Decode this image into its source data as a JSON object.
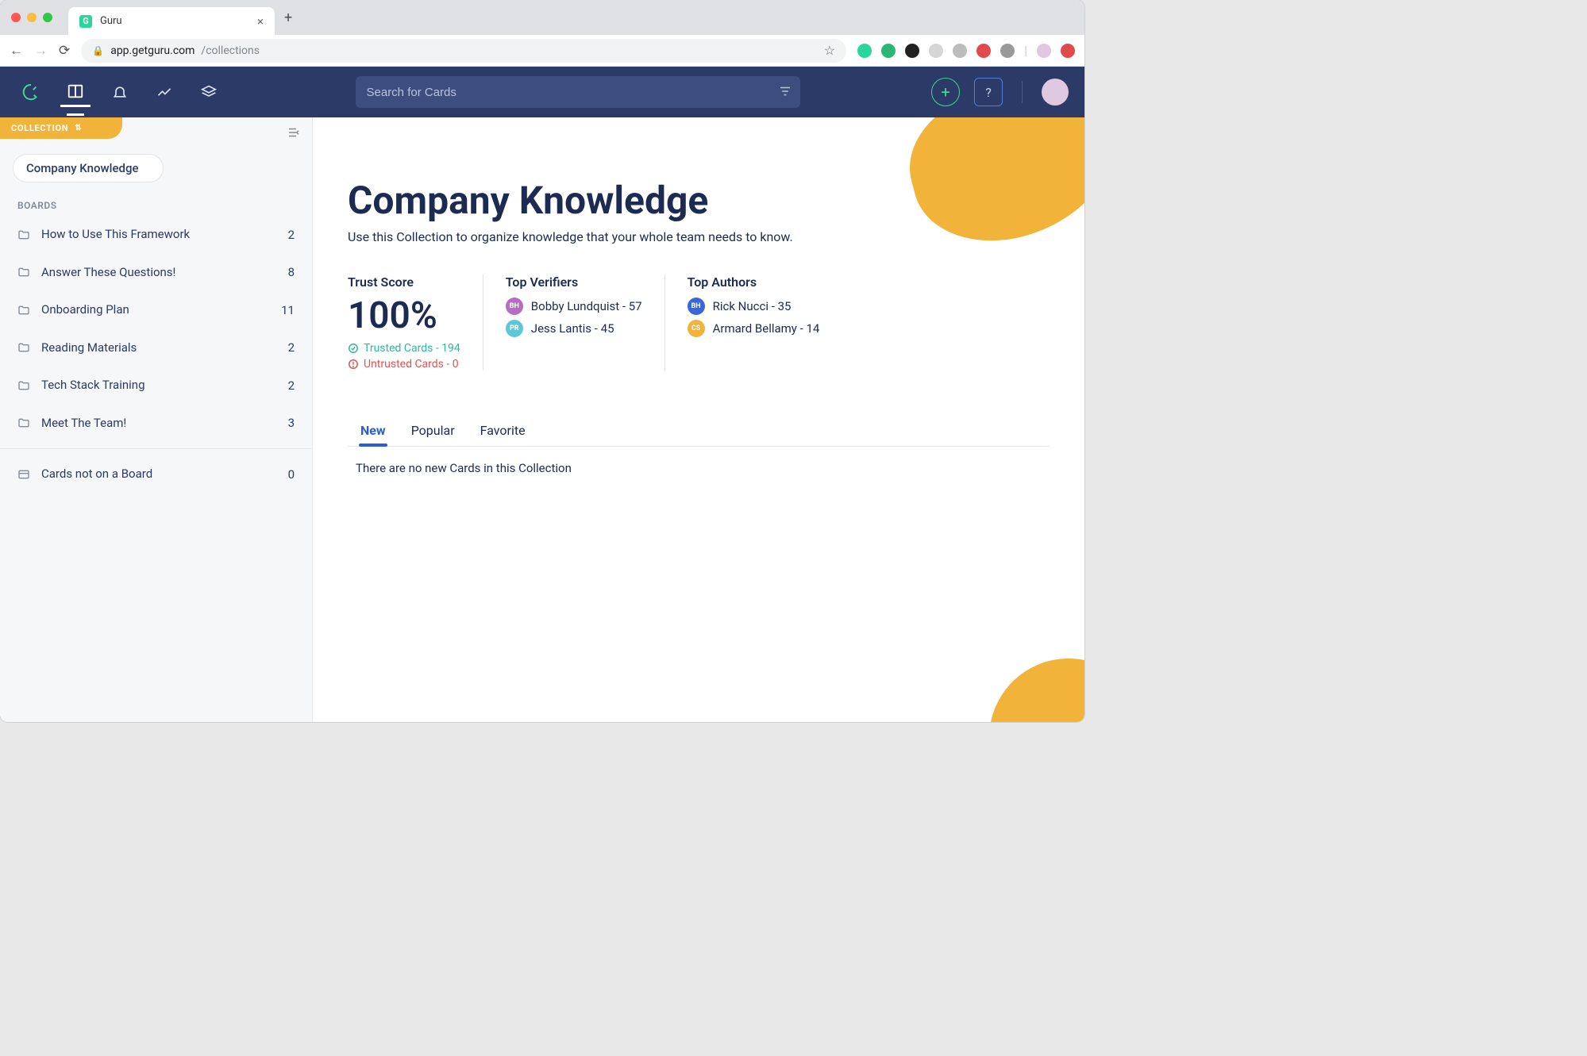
{
  "browser": {
    "tab_title": "Guru",
    "url_domain": "app.getguru.com",
    "url_path": "/collections"
  },
  "header": {
    "search_placeholder": "Search for Cards"
  },
  "sidebar": {
    "collection_label": "COLLECTION",
    "collection_name": "Company Knowledge",
    "boards_label": "BOARDS",
    "boards": [
      {
        "name": "How to Use This Framework",
        "count": "2"
      },
      {
        "name": "Answer These Questions!",
        "count": "8"
      },
      {
        "name": "Onboarding Plan",
        "count": "11"
      },
      {
        "name": "Reading Materials",
        "count": "2"
      },
      {
        "name": "Tech Stack Training",
        "count": "2"
      },
      {
        "name": "Meet The Team!",
        "count": "3"
      }
    ],
    "orphan": {
      "name": "Cards not on a Board",
      "count": "0"
    }
  },
  "main": {
    "title": "Company Knowledge",
    "subtitle": "Use this Collection to organize knowledge that your whole team needs to know.",
    "trust": {
      "label": "Trust Score",
      "value": "100%",
      "trusted": "Trusted Cards - 194",
      "untrusted": "Untrusted Cards - 0"
    },
    "verifiers": {
      "label": "Top Verifiers",
      "people": [
        {
          "initials": "BH",
          "color": "#b56cc3",
          "text": "Bobby Lundquist - 57"
        },
        {
          "initials": "PR",
          "color": "#5fc7d4",
          "text": "Jess Lantis  - 45"
        }
      ]
    },
    "authors": {
      "label": "Top Authors",
      "people": [
        {
          "initials": "BH",
          "color": "#3a67d6",
          "text": "Rick Nucci - 35"
        },
        {
          "initials": "CS",
          "color": "#f2b33a",
          "text": "Armard Bellamy - 14"
        }
      ]
    },
    "tabs": {
      "new": "New",
      "popular": "Popular",
      "favorite": "Favorite"
    },
    "empty": "There are no new Cards in this Collection"
  }
}
